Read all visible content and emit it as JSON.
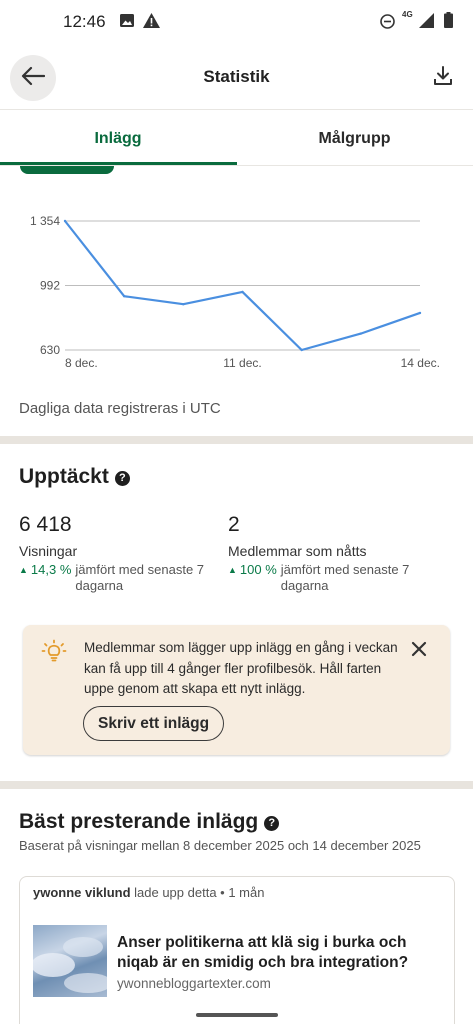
{
  "status_bar": {
    "time": "12:46",
    "network": "4G"
  },
  "header": {
    "title": "Statistik"
  },
  "tabs": [
    {
      "label": "Inlägg",
      "selected": true
    },
    {
      "label": "Målgrupp",
      "selected": false
    }
  ],
  "chart_data": {
    "type": "line",
    "x": [
      "8 dec.",
      "9 dec.",
      "10 dec.",
      "11 dec.",
      "12 dec.",
      "13 dec.",
      "14 dec."
    ],
    "values": [
      1354,
      932,
      887,
      956,
      630,
      722,
      838
    ],
    "y_ticks": [
      "1 354",
      "992",
      "630"
    ],
    "x_tick_labels": [
      "8 dec.",
      "11 dec.",
      "14 dec."
    ],
    "ylim": [
      630,
      1354
    ],
    "grid": true,
    "line_color": "#4a8fe0"
  },
  "chart_note": "Dagliga data registreras i UTC",
  "discovery": {
    "title": "Upptäckt",
    "metrics": [
      {
        "value": "6 418",
        "label": "Visningar",
        "change": "14,3 %",
        "comparison": "jämfört med senaste 7 dagarna"
      },
      {
        "value": "2",
        "label": "Medlemmar som nåtts",
        "change": "100 %",
        "comparison": "jämfört med senaste 7 dagarna"
      }
    ],
    "positive_color": "#0a7a48"
  },
  "tip": {
    "text": "Medlemmar som lägger upp inlägg en gång i veckan kan få upp till 4 gånger fler profilbesök. Håll farten uppe genom att skapa ett nytt inlägg.",
    "button_label": "Skriv ett inlägg"
  },
  "top_posts": {
    "title": "Bäst presterande inlägg",
    "subtitle": "Baserat på visningar mellan 8 december 2025 och 14 december 2025",
    "post": {
      "author": "ywonne viklund",
      "action": "lade upp detta • 1 mån",
      "headline": "Anser politikerna att klä sig i burka och niqab är en smidig och bra integration?",
      "domain": "ywonnebloggartexter.com"
    }
  },
  "colors": {
    "accent_green": "#0a6b3e",
    "tip_background": "#f7ede0",
    "divider": "#e8e4de"
  }
}
